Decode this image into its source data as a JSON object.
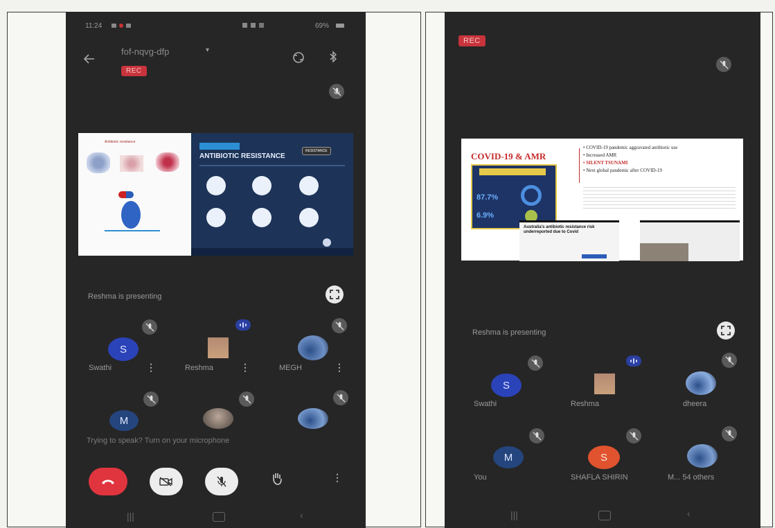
{
  "left_phone": {
    "status_time": "11:24",
    "status_battery": "69%",
    "meeting_code": "fof-nqvg-dfp",
    "rec_label": "REC",
    "presenting_text": "Reshma is presenting",
    "slide_left": {
      "title": "Antibiotic resistance"
    },
    "slide_right": {
      "title": "ANTIBIOTIC RESISTANCE",
      "badge": "RESISTANCE"
    },
    "participants_row1": [
      {
        "name": "Swathi",
        "initial": "S"
      },
      {
        "name": "Reshma"
      },
      {
        "name": "MEGH"
      }
    ],
    "participants_row2": [
      {
        "initial": "M"
      }
    ],
    "hint_text": "Trying to speak? Turn on your microphone"
  },
  "right_phone": {
    "rec_label": "REC",
    "presenting_text": "Reshma is presenting",
    "slide": {
      "title": "COVID-19 & AMR",
      "bullets": [
        "COVID-19 pandemic aggravated antibiotic use",
        "Increased AMR",
        "SILENT TSUNAMI",
        "Next global pandemic after COVID-19"
      ],
      "stat1": "87.7%",
      "stat2": "6.9%",
      "headline": "Australia's antibiotic resistance risk underreported due to Covid"
    },
    "participants_row1": [
      {
        "name": "Swathi",
        "initial": "S"
      },
      {
        "name": "Reshma"
      },
      {
        "name": "dheera"
      }
    ],
    "participants_row2": [
      {
        "name": "You",
        "initial": "M"
      },
      {
        "name": "SHAFLA SHIRIN",
        "initial": "S"
      },
      {
        "name": "M... 54 others"
      }
    ]
  },
  "colors": {
    "blue_avatar": "#2b43b8",
    "orange_avatar": "#e0532e",
    "end_call": "#e0353f",
    "rec": "#c8343c"
  }
}
